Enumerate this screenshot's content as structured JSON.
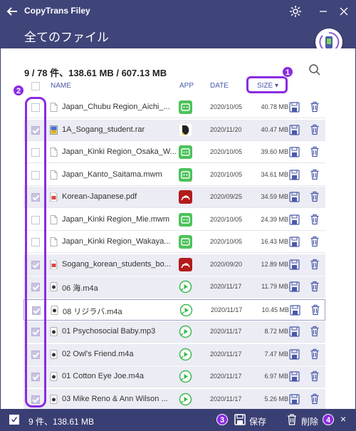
{
  "app": {
    "title": "CopyTrans Filey",
    "page_title": "全てのファイル"
  },
  "summary": "9 / 78 件、138.61 MB / 607.13 MB",
  "columns": {
    "name": "NAME",
    "app": "APP",
    "date": "DATE",
    "size": "SIZE"
  },
  "files": [
    {
      "name": "Japan_Chubu Region_Aichi_...",
      "app": "green",
      "date": "2020/10/05",
      "size": "40.78 MB",
      "selected": false,
      "type": "doc"
    },
    {
      "name": "1A_Sogang_student.rar",
      "app": "d",
      "date": "2020/11/20",
      "size": "40.47 MB",
      "selected": true,
      "type": "rar"
    },
    {
      "name": "Japan_Kinki Region_Osaka_W...",
      "app": "green",
      "date": "2020/10/05",
      "size": "39.60 MB",
      "selected": false,
      "type": "doc"
    },
    {
      "name": "Japan_Kanto_Saitama.mwm",
      "app": "green",
      "date": "2020/10/05",
      "size": "34.61 MB",
      "selected": false,
      "type": "doc"
    },
    {
      "name": "Korean-Japanese.pdf",
      "app": "pdf",
      "date": "2020/09/25",
      "size": "34.59 MB",
      "selected": true,
      "type": "pdf"
    },
    {
      "name": "Japan_Kinki Region_Mie.mwm",
      "app": "green",
      "date": "2020/10/05",
      "size": "24.39 MB",
      "selected": false,
      "type": "doc"
    },
    {
      "name": "Japan_Kinki Region_Wakaya...",
      "app": "green",
      "date": "2020/10/05",
      "size": "16.43 MB",
      "selected": false,
      "type": "doc"
    },
    {
      "name": "Sogang_korean_students_bo...",
      "app": "pdf",
      "date": "2020/09/20",
      "size": "12.89 MB",
      "selected": true,
      "type": "pdf"
    },
    {
      "name": "06 海.m4a",
      "app": "play",
      "date": "2020/11/17",
      "size": "11.79 MB",
      "selected": true,
      "type": "audio"
    },
    {
      "name": "08 リジラバ.m4a",
      "app": "play",
      "date": "2020/11/17",
      "size": "10.45 MB",
      "selected": true,
      "type": "audio"
    },
    {
      "name": "01 Psychosocial Baby.mp3",
      "app": "play",
      "date": "2020/11/17",
      "size": "8.72 MB",
      "selected": true,
      "type": "audio"
    },
    {
      "name": "02 Owl's Friend.m4a",
      "app": "play",
      "date": "2020/11/17",
      "size": "7.47 MB",
      "selected": true,
      "type": "audio"
    },
    {
      "name": "01 Cotton Eye Joe.m4a",
      "app": "play",
      "date": "2020/11/17",
      "size": "6.97 MB",
      "selected": true,
      "type": "audio"
    },
    {
      "name": "03 Mike Reno & Ann Wilson ...",
      "app": "play",
      "date": "2020/11/17",
      "size": "5.26 MB",
      "selected": true,
      "type": "audio"
    }
  ],
  "bottom": {
    "count": "9 件、138.61 MB",
    "save": "保存",
    "delete": "削除",
    "close": "×"
  },
  "callouts": [
    "1",
    "2",
    "3",
    "4"
  ],
  "colors": {
    "header": "#3f4479",
    "accent": "#8a2be2",
    "green_app": "#4cc35a",
    "pdf_app": "#b41b1b"
  }
}
